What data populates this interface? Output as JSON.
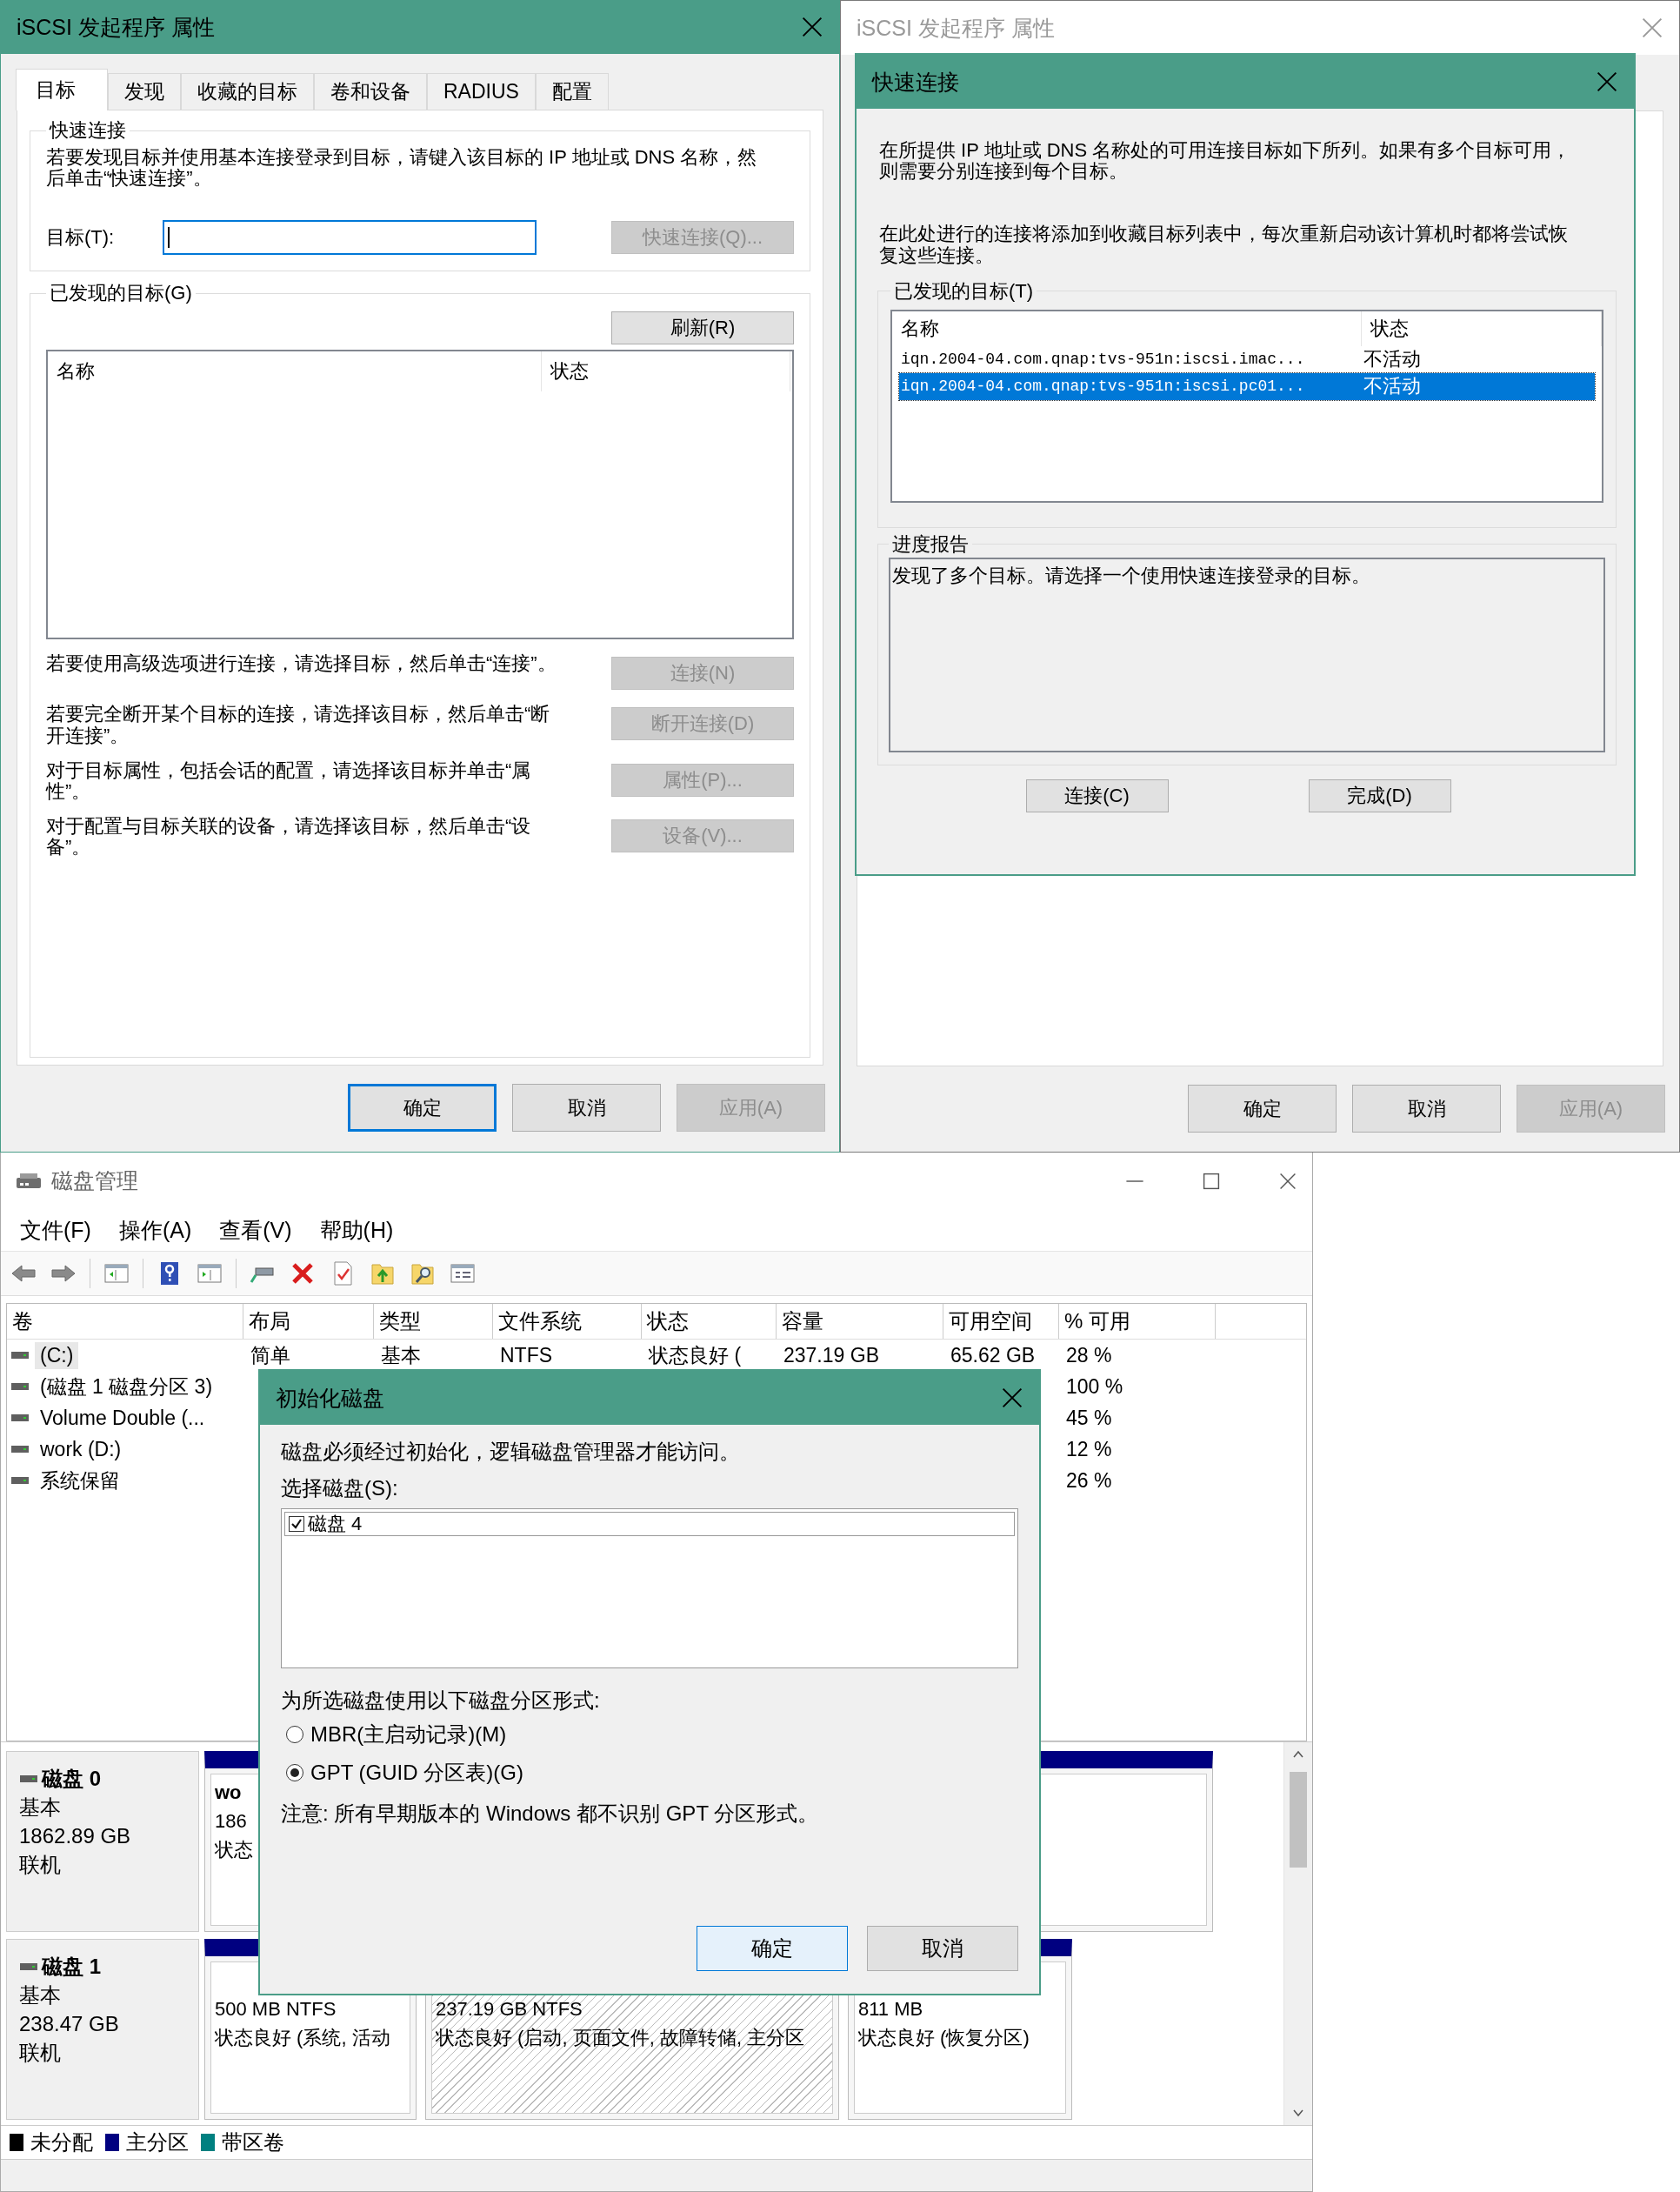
{
  "iscsi_window": {
    "title": "iSCSI 发起程序 属性",
    "active": true,
    "tabs": [
      {
        "label": "目标",
        "selected": true
      },
      {
        "label": "发现",
        "selected": false
      },
      {
        "label": "收藏的目标",
        "selected": false
      },
      {
        "label": "卷和设备",
        "selected": false
      },
      {
        "label": "RADIUS",
        "selected": false
      },
      {
        "label": "配置",
        "selected": false
      }
    ],
    "quick_connect": {
      "legend": "快速连接",
      "description": "若要发现目标并使用基本连接登录到目标，请键入该目标的 IP 地址或 DNS 名称，然后单击“快速连接”。",
      "target_label": "目标(T):",
      "button": {
        "label": "快速连接(Q)...",
        "disabled": true
      }
    },
    "discovered_targets": {
      "legend": "已发现的目标(G)",
      "refresh_button": "刷新(R)",
      "columns": [
        "名称",
        "状态"
      ]
    },
    "actions": [
      {
        "text": "若要使用高级选项进行连接，请选择目标，然后单击“连接”。",
        "button": "连接(N)",
        "disabled": true
      },
      {
        "text": "若要完全断开某个目标的连接，请选择该目标，然后单击“断开连接”。",
        "button": "断开连接(D)",
        "disabled": true
      },
      {
        "text": "对于目标属性，包括会话的配置，请选择该目标并单击“属性”。",
        "button": "属性(P)...",
        "disabled": true
      },
      {
        "text": "对于配置与目标关联的设备，请选择该目标，然后单击“设备”。",
        "button": "设备(V)...",
        "disabled": true
      }
    ],
    "buttons": [
      {
        "label": "确定",
        "default": true,
        "disabled": false
      },
      {
        "label": "取消",
        "default": false,
        "disabled": false
      },
      {
        "label": "应用(A)",
        "default": false,
        "disabled": true
      }
    ]
  },
  "background_window": {
    "title": "iSCSI 发起程序 属性",
    "active": false,
    "buttons": [
      {
        "label": "确定",
        "default": false,
        "disabled": false
      },
      {
        "label": "取消",
        "default": false,
        "disabled": false
      },
      {
        "label": "应用(A)",
        "default": false,
        "disabled": true
      }
    ]
  },
  "quick_connect_dialog": {
    "title": "快速连接",
    "paragraphs": [
      "在所提供 IP 地址或 DNS 名称处的可用连接目标如下所列。如果有多个目标可用，则需要分别连接到每个目标。",
      "在此处进行的连接将添加到收藏目标列表中，每次重新启动该计算机时都将尝试恢复这些连接。"
    ],
    "targets": {
      "legend": "已发现的目标(T)",
      "columns": [
        "名称",
        "状态"
      ],
      "rows": [
        {
          "name": "iqn.2004-04.com.qnap:tvs-951n:iscsi.imac...",
          "status": "不活动",
          "selected": false
        },
        {
          "name": "iqn.2004-04.com.qnap:tvs-951n:iscsi.pc01...",
          "status": "不活动",
          "selected": true
        }
      ]
    },
    "progress": {
      "legend": "进度报告",
      "text": "发现了多个目标。请选择一个使用快速连接登录的目标。"
    },
    "buttons": [
      "连接(C)",
      "完成(D)"
    ]
  },
  "disk_management": {
    "title": "磁盘管理",
    "menu": [
      "文件(F)",
      "操作(A)",
      "查看(V)",
      "帮助(H)"
    ],
    "volumes": {
      "columns": [
        "卷",
        "布局",
        "类型",
        "文件系统",
        "状态",
        "容量",
        "可用空间",
        "% 可用"
      ],
      "rows": [
        {
          "volume": "(C:)",
          "layout": "简单",
          "type": "基本",
          "file_system": "NTFS",
          "status": "状态良好 (",
          "capacity": "237.19 GB",
          "free_space": "65.62 GB",
          "percent_free": "28 %",
          "selected": true
        },
        {
          "volume": "(磁盘 1 磁盘分区 3)",
          "percent_free": "100 %",
          "selected": false
        },
        {
          "volume": "Volume Double (...",
          "percent_free": "45 %",
          "selected": false
        },
        {
          "volume": "work (D:)",
          "percent_free": "12 %",
          "selected": false
        },
        {
          "volume": "系统保留",
          "percent_free": "26 %",
          "selected": false
        }
      ]
    },
    "disks": [
      {
        "name": "磁盘 0",
        "type": "基本",
        "size": "1862.89 GB",
        "status": "联机",
        "partitions": [
          {
            "kind": "primary",
            "label": "wo",
            "size": "186",
            "status": "状态",
            "selected": false
          }
        ]
      },
      {
        "name": "磁盘 1",
        "type": "基本",
        "size": "238.47 GB",
        "status": "联机",
        "partitions": [
          {
            "kind": "primary",
            "size": "500 MB NTFS",
            "status": "状态良好 (系统, 活动",
            "selected": false
          },
          {
            "kind": "primary",
            "size": "237.19 GB NTFS",
            "status": "状态良好 (启动, 页面文件, 故障转储, 主分区",
            "selected": true
          },
          {
            "kind": "primary",
            "size": "811 MB",
            "status": "状态良好 (恢复分区)",
            "selected": false
          }
        ]
      }
    ],
    "legend": [
      {
        "label": "未分配",
        "color": "#000000"
      },
      {
        "label": "主分区",
        "color": "#000080"
      },
      {
        "label": "带区卷",
        "color": "#008080"
      }
    ]
  },
  "initialize_disk_dialog": {
    "title": "初始化磁盘",
    "message": "磁盘必须经过初始化，逻辑磁盘管理器才能访问。",
    "select_label": "选择磁盘(S):",
    "disks": [
      {
        "label": "磁盘 4",
        "checked": true
      }
    ],
    "style_label": "为所选磁盘使用以下磁盘分区形式:",
    "options": [
      {
        "label": "MBR(主启动记录)(M)",
        "selected": false
      },
      {
        "label": "GPT (GUID 分区表)(G)",
        "selected": true
      }
    ],
    "note": "注意: 所有早期版本的 Windows 都不识别 GPT 分区形式。",
    "buttons": [
      {
        "label": "确定",
        "default": true
      },
      {
        "label": "取消",
        "default": false
      }
    ]
  }
}
